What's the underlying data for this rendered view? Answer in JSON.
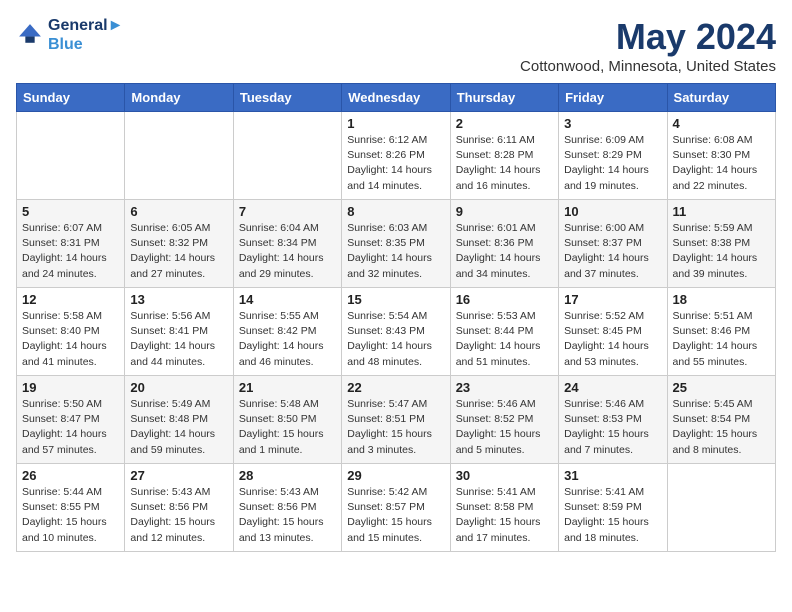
{
  "header": {
    "logo": {
      "line1": "General",
      "line2": "Blue"
    },
    "title": "May 2024",
    "location": "Cottonwood, Minnesota, United States"
  },
  "weekdays": [
    "Sunday",
    "Monday",
    "Tuesday",
    "Wednesday",
    "Thursday",
    "Friday",
    "Saturday"
  ],
  "weeks": [
    [
      {
        "day": "",
        "info": ""
      },
      {
        "day": "",
        "info": ""
      },
      {
        "day": "",
        "info": ""
      },
      {
        "day": "1",
        "info": "Sunrise: 6:12 AM\nSunset: 8:26 PM\nDaylight: 14 hours\nand 14 minutes."
      },
      {
        "day": "2",
        "info": "Sunrise: 6:11 AM\nSunset: 8:28 PM\nDaylight: 14 hours\nand 16 minutes."
      },
      {
        "day": "3",
        "info": "Sunrise: 6:09 AM\nSunset: 8:29 PM\nDaylight: 14 hours\nand 19 minutes."
      },
      {
        "day": "4",
        "info": "Sunrise: 6:08 AM\nSunset: 8:30 PM\nDaylight: 14 hours\nand 22 minutes."
      }
    ],
    [
      {
        "day": "5",
        "info": "Sunrise: 6:07 AM\nSunset: 8:31 PM\nDaylight: 14 hours\nand 24 minutes."
      },
      {
        "day": "6",
        "info": "Sunrise: 6:05 AM\nSunset: 8:32 PM\nDaylight: 14 hours\nand 27 minutes."
      },
      {
        "day": "7",
        "info": "Sunrise: 6:04 AM\nSunset: 8:34 PM\nDaylight: 14 hours\nand 29 minutes."
      },
      {
        "day": "8",
        "info": "Sunrise: 6:03 AM\nSunset: 8:35 PM\nDaylight: 14 hours\nand 32 minutes."
      },
      {
        "day": "9",
        "info": "Sunrise: 6:01 AM\nSunset: 8:36 PM\nDaylight: 14 hours\nand 34 minutes."
      },
      {
        "day": "10",
        "info": "Sunrise: 6:00 AM\nSunset: 8:37 PM\nDaylight: 14 hours\nand 37 minutes."
      },
      {
        "day": "11",
        "info": "Sunrise: 5:59 AM\nSunset: 8:38 PM\nDaylight: 14 hours\nand 39 minutes."
      }
    ],
    [
      {
        "day": "12",
        "info": "Sunrise: 5:58 AM\nSunset: 8:40 PM\nDaylight: 14 hours\nand 41 minutes."
      },
      {
        "day": "13",
        "info": "Sunrise: 5:56 AM\nSunset: 8:41 PM\nDaylight: 14 hours\nand 44 minutes."
      },
      {
        "day": "14",
        "info": "Sunrise: 5:55 AM\nSunset: 8:42 PM\nDaylight: 14 hours\nand 46 minutes."
      },
      {
        "day": "15",
        "info": "Sunrise: 5:54 AM\nSunset: 8:43 PM\nDaylight: 14 hours\nand 48 minutes."
      },
      {
        "day": "16",
        "info": "Sunrise: 5:53 AM\nSunset: 8:44 PM\nDaylight: 14 hours\nand 51 minutes."
      },
      {
        "day": "17",
        "info": "Sunrise: 5:52 AM\nSunset: 8:45 PM\nDaylight: 14 hours\nand 53 minutes."
      },
      {
        "day": "18",
        "info": "Sunrise: 5:51 AM\nSunset: 8:46 PM\nDaylight: 14 hours\nand 55 minutes."
      }
    ],
    [
      {
        "day": "19",
        "info": "Sunrise: 5:50 AM\nSunset: 8:47 PM\nDaylight: 14 hours\nand 57 minutes."
      },
      {
        "day": "20",
        "info": "Sunrise: 5:49 AM\nSunset: 8:48 PM\nDaylight: 14 hours\nand 59 minutes."
      },
      {
        "day": "21",
        "info": "Sunrise: 5:48 AM\nSunset: 8:50 PM\nDaylight: 15 hours\nand 1 minute."
      },
      {
        "day": "22",
        "info": "Sunrise: 5:47 AM\nSunset: 8:51 PM\nDaylight: 15 hours\nand 3 minutes."
      },
      {
        "day": "23",
        "info": "Sunrise: 5:46 AM\nSunset: 8:52 PM\nDaylight: 15 hours\nand 5 minutes."
      },
      {
        "day": "24",
        "info": "Sunrise: 5:46 AM\nSunset: 8:53 PM\nDaylight: 15 hours\nand 7 minutes."
      },
      {
        "day": "25",
        "info": "Sunrise: 5:45 AM\nSunset: 8:54 PM\nDaylight: 15 hours\nand 8 minutes."
      }
    ],
    [
      {
        "day": "26",
        "info": "Sunrise: 5:44 AM\nSunset: 8:55 PM\nDaylight: 15 hours\nand 10 minutes."
      },
      {
        "day": "27",
        "info": "Sunrise: 5:43 AM\nSunset: 8:56 PM\nDaylight: 15 hours\nand 12 minutes."
      },
      {
        "day": "28",
        "info": "Sunrise: 5:43 AM\nSunset: 8:56 PM\nDaylight: 15 hours\nand 13 minutes."
      },
      {
        "day": "29",
        "info": "Sunrise: 5:42 AM\nSunset: 8:57 PM\nDaylight: 15 hours\nand 15 minutes."
      },
      {
        "day": "30",
        "info": "Sunrise: 5:41 AM\nSunset: 8:58 PM\nDaylight: 15 hours\nand 17 minutes."
      },
      {
        "day": "31",
        "info": "Sunrise: 5:41 AM\nSunset: 8:59 PM\nDaylight: 15 hours\nand 18 minutes."
      },
      {
        "day": "",
        "info": ""
      }
    ]
  ]
}
